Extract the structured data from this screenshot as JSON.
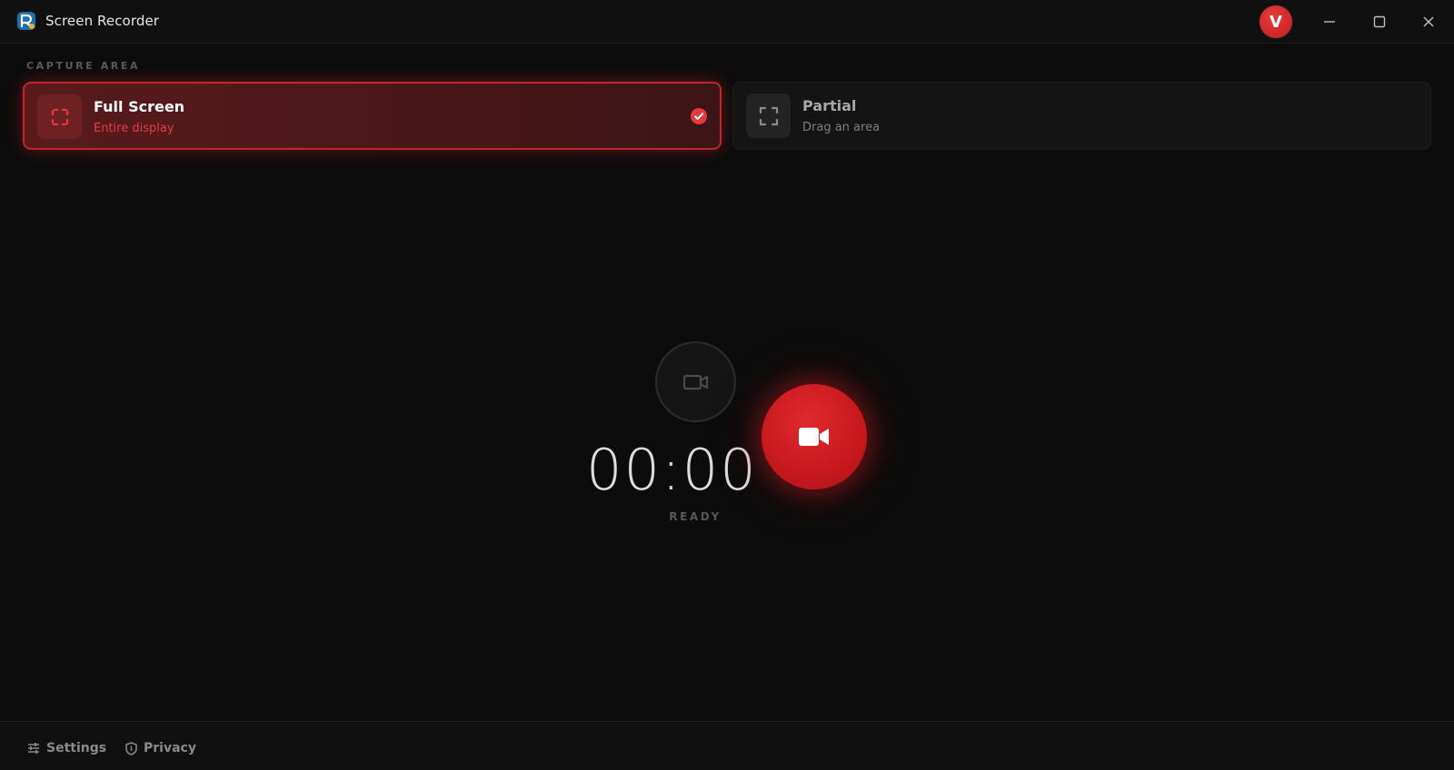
{
  "window": {
    "title": "Screen Recorder",
    "avatar_initial": "V"
  },
  "capture_area": {
    "label": "CAPTURE AREA",
    "options": [
      {
        "title": "Full Screen",
        "subtitle": "Entire display",
        "selected": true
      },
      {
        "title": "Partial",
        "subtitle": "Drag an area",
        "selected": false
      }
    ]
  },
  "recorder": {
    "timer": "00:00",
    "status": "READY"
  },
  "footer": {
    "settings_label": "Settings",
    "privacy_label": "Privacy"
  },
  "colors": {
    "accent": "#c7181d",
    "background": "#0c0c0c"
  },
  "icons": {
    "app": "app-logo-icon",
    "minimize": "minimize-icon",
    "maximize": "maximize-icon",
    "close": "close-icon",
    "full_screen": "fullscreen-icon",
    "partial": "partial-area-icon",
    "selected": "check-circle-icon",
    "camera": "camera-icon",
    "record": "video-camera-icon",
    "settings": "sliders-icon",
    "privacy": "shield-icon"
  }
}
